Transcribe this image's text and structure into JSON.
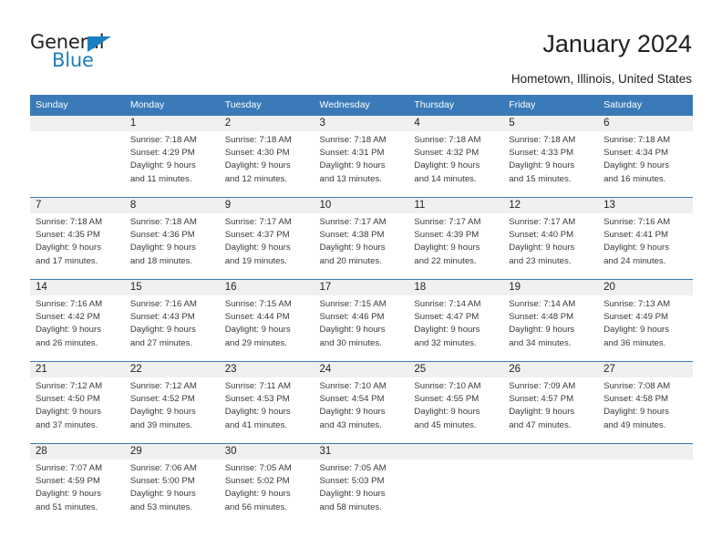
{
  "brand": {
    "name_top": "General",
    "name_bottom": "Blue"
  },
  "header": {
    "title": "January 2024",
    "location": "Hometown, Illinois, United States"
  },
  "colors": {
    "header_blue": "#3b7ab8",
    "brand_blue": "#1a7fc1",
    "daynum_band": "#f0f0f0",
    "text": "#231f20"
  },
  "weekday_headers": [
    "Sunday",
    "Monday",
    "Tuesday",
    "Wednesday",
    "Thursday",
    "Friday",
    "Saturday"
  ],
  "weeks": [
    [
      {
        "day": "",
        "sunrise": "",
        "sunset": "",
        "daylight_1": "",
        "daylight_2": ""
      },
      {
        "day": "1",
        "sunrise": "Sunrise: 7:18 AM",
        "sunset": "Sunset: 4:29 PM",
        "daylight_1": "Daylight: 9 hours",
        "daylight_2": "and 11 minutes."
      },
      {
        "day": "2",
        "sunrise": "Sunrise: 7:18 AM",
        "sunset": "Sunset: 4:30 PM",
        "daylight_1": "Daylight: 9 hours",
        "daylight_2": "and 12 minutes."
      },
      {
        "day": "3",
        "sunrise": "Sunrise: 7:18 AM",
        "sunset": "Sunset: 4:31 PM",
        "daylight_1": "Daylight: 9 hours",
        "daylight_2": "and 13 minutes."
      },
      {
        "day": "4",
        "sunrise": "Sunrise: 7:18 AM",
        "sunset": "Sunset: 4:32 PM",
        "daylight_1": "Daylight: 9 hours",
        "daylight_2": "and 14 minutes."
      },
      {
        "day": "5",
        "sunrise": "Sunrise: 7:18 AM",
        "sunset": "Sunset: 4:33 PM",
        "daylight_1": "Daylight: 9 hours",
        "daylight_2": "and 15 minutes."
      },
      {
        "day": "6",
        "sunrise": "Sunrise: 7:18 AM",
        "sunset": "Sunset: 4:34 PM",
        "daylight_1": "Daylight: 9 hours",
        "daylight_2": "and 16 minutes."
      }
    ],
    [
      {
        "day": "7",
        "sunrise": "Sunrise: 7:18 AM",
        "sunset": "Sunset: 4:35 PM",
        "daylight_1": "Daylight: 9 hours",
        "daylight_2": "and 17 minutes."
      },
      {
        "day": "8",
        "sunrise": "Sunrise: 7:18 AM",
        "sunset": "Sunset: 4:36 PM",
        "daylight_1": "Daylight: 9 hours",
        "daylight_2": "and 18 minutes."
      },
      {
        "day": "9",
        "sunrise": "Sunrise: 7:17 AM",
        "sunset": "Sunset: 4:37 PM",
        "daylight_1": "Daylight: 9 hours",
        "daylight_2": "and 19 minutes."
      },
      {
        "day": "10",
        "sunrise": "Sunrise: 7:17 AM",
        "sunset": "Sunset: 4:38 PM",
        "daylight_1": "Daylight: 9 hours",
        "daylight_2": "and 20 minutes."
      },
      {
        "day": "11",
        "sunrise": "Sunrise: 7:17 AM",
        "sunset": "Sunset: 4:39 PM",
        "daylight_1": "Daylight: 9 hours",
        "daylight_2": "and 22 minutes."
      },
      {
        "day": "12",
        "sunrise": "Sunrise: 7:17 AM",
        "sunset": "Sunset: 4:40 PM",
        "daylight_1": "Daylight: 9 hours",
        "daylight_2": "and 23 minutes."
      },
      {
        "day": "13",
        "sunrise": "Sunrise: 7:16 AM",
        "sunset": "Sunset: 4:41 PM",
        "daylight_1": "Daylight: 9 hours",
        "daylight_2": "and 24 minutes."
      }
    ],
    [
      {
        "day": "14",
        "sunrise": "Sunrise: 7:16 AM",
        "sunset": "Sunset: 4:42 PM",
        "daylight_1": "Daylight: 9 hours",
        "daylight_2": "and 26 minutes."
      },
      {
        "day": "15",
        "sunrise": "Sunrise: 7:16 AM",
        "sunset": "Sunset: 4:43 PM",
        "daylight_1": "Daylight: 9 hours",
        "daylight_2": "and 27 minutes."
      },
      {
        "day": "16",
        "sunrise": "Sunrise: 7:15 AM",
        "sunset": "Sunset: 4:44 PM",
        "daylight_1": "Daylight: 9 hours",
        "daylight_2": "and 29 minutes."
      },
      {
        "day": "17",
        "sunrise": "Sunrise: 7:15 AM",
        "sunset": "Sunset: 4:46 PM",
        "daylight_1": "Daylight: 9 hours",
        "daylight_2": "and 30 minutes."
      },
      {
        "day": "18",
        "sunrise": "Sunrise: 7:14 AM",
        "sunset": "Sunset: 4:47 PM",
        "daylight_1": "Daylight: 9 hours",
        "daylight_2": "and 32 minutes."
      },
      {
        "day": "19",
        "sunrise": "Sunrise: 7:14 AM",
        "sunset": "Sunset: 4:48 PM",
        "daylight_1": "Daylight: 9 hours",
        "daylight_2": "and 34 minutes."
      },
      {
        "day": "20",
        "sunrise": "Sunrise: 7:13 AM",
        "sunset": "Sunset: 4:49 PM",
        "daylight_1": "Daylight: 9 hours",
        "daylight_2": "and 36 minutes."
      }
    ],
    [
      {
        "day": "21",
        "sunrise": "Sunrise: 7:12 AM",
        "sunset": "Sunset: 4:50 PM",
        "daylight_1": "Daylight: 9 hours",
        "daylight_2": "and 37 minutes."
      },
      {
        "day": "22",
        "sunrise": "Sunrise: 7:12 AM",
        "sunset": "Sunset: 4:52 PM",
        "daylight_1": "Daylight: 9 hours",
        "daylight_2": "and 39 minutes."
      },
      {
        "day": "23",
        "sunrise": "Sunrise: 7:11 AM",
        "sunset": "Sunset: 4:53 PM",
        "daylight_1": "Daylight: 9 hours",
        "daylight_2": "and 41 minutes."
      },
      {
        "day": "24",
        "sunrise": "Sunrise: 7:10 AM",
        "sunset": "Sunset: 4:54 PM",
        "daylight_1": "Daylight: 9 hours",
        "daylight_2": "and 43 minutes."
      },
      {
        "day": "25",
        "sunrise": "Sunrise: 7:10 AM",
        "sunset": "Sunset: 4:55 PM",
        "daylight_1": "Daylight: 9 hours",
        "daylight_2": "and 45 minutes."
      },
      {
        "day": "26",
        "sunrise": "Sunrise: 7:09 AM",
        "sunset": "Sunset: 4:57 PM",
        "daylight_1": "Daylight: 9 hours",
        "daylight_2": "and 47 minutes."
      },
      {
        "day": "27",
        "sunrise": "Sunrise: 7:08 AM",
        "sunset": "Sunset: 4:58 PM",
        "daylight_1": "Daylight: 9 hours",
        "daylight_2": "and 49 minutes."
      }
    ],
    [
      {
        "day": "28",
        "sunrise": "Sunrise: 7:07 AM",
        "sunset": "Sunset: 4:59 PM",
        "daylight_1": "Daylight: 9 hours",
        "daylight_2": "and 51 minutes."
      },
      {
        "day": "29",
        "sunrise": "Sunrise: 7:06 AM",
        "sunset": "Sunset: 5:00 PM",
        "daylight_1": "Daylight: 9 hours",
        "daylight_2": "and 53 minutes."
      },
      {
        "day": "30",
        "sunrise": "Sunrise: 7:05 AM",
        "sunset": "Sunset: 5:02 PM",
        "daylight_1": "Daylight: 9 hours",
        "daylight_2": "and 56 minutes."
      },
      {
        "day": "31",
        "sunrise": "Sunrise: 7:05 AM",
        "sunset": "Sunset: 5:03 PM",
        "daylight_1": "Daylight: 9 hours",
        "daylight_2": "and 58 minutes."
      },
      {
        "day": "",
        "sunrise": "",
        "sunset": "",
        "daylight_1": "",
        "daylight_2": ""
      },
      {
        "day": "",
        "sunrise": "",
        "sunset": "",
        "daylight_1": "",
        "daylight_2": ""
      },
      {
        "day": "",
        "sunrise": "",
        "sunset": "",
        "daylight_1": "",
        "daylight_2": ""
      }
    ]
  ]
}
